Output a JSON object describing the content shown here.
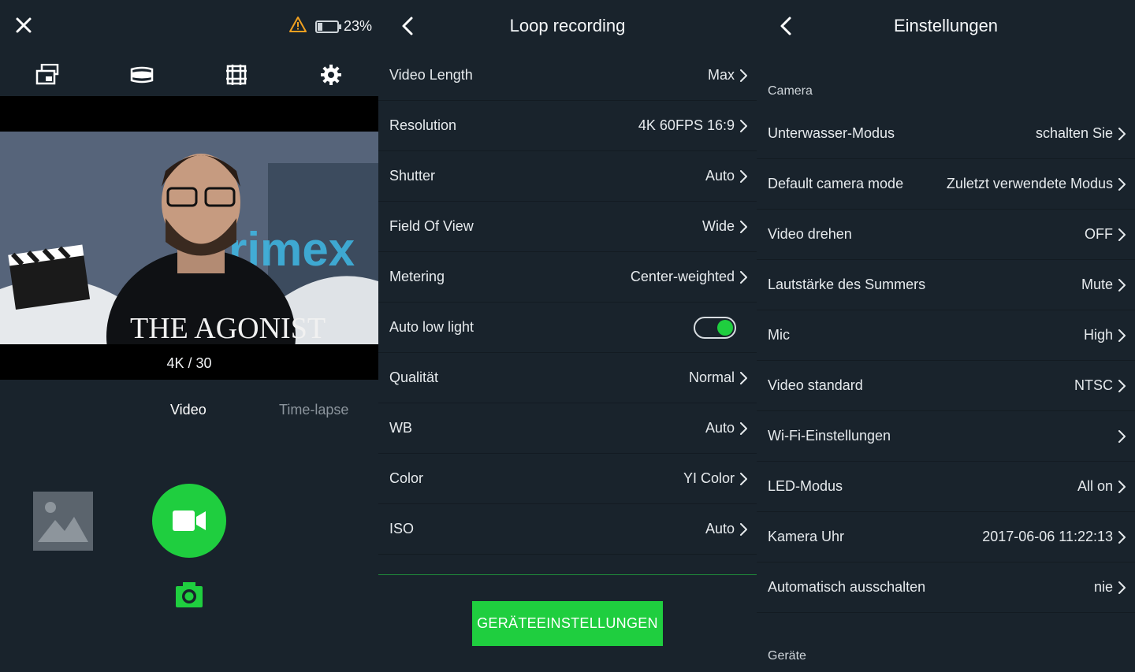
{
  "camera": {
    "battery_percent": "23%",
    "battery_level": 0.23,
    "resolution_label": "4K / 30",
    "mode_video": "Video",
    "mode_timelapse": "Time-lapse",
    "preview_scene_text": "THE AGONIST",
    "preview_banner_text": "rimex"
  },
  "loop": {
    "title": "Loop recording",
    "rows": [
      {
        "label": "Video Length",
        "value": "Max"
      },
      {
        "label": "Resolution",
        "value": "4K 60FPS 16:9"
      },
      {
        "label": "Shutter",
        "value": "Auto"
      },
      {
        "label": "Field Of View",
        "value": "Wide"
      },
      {
        "label": "Metering",
        "value": "Center-weighted"
      },
      {
        "label": "Auto low light",
        "value": "",
        "toggle": true
      },
      {
        "label": "Qualität",
        "value": "Normal"
      },
      {
        "label": "WB",
        "value": "Auto"
      },
      {
        "label": "Color",
        "value": "YI Color"
      },
      {
        "label": "ISO",
        "value": "Auto"
      }
    ],
    "device_button": "GERÄTEEINSTELLUNGEN"
  },
  "einst": {
    "title": "Einstellungen",
    "section_camera": "Camera",
    "section_devices": "Geräte",
    "rows": [
      {
        "label": "Unterwasser-Modus",
        "value": "schalten Sie"
      },
      {
        "label": "Default camera mode",
        "value": "Zuletzt verwendete Modus"
      },
      {
        "label": "Video drehen",
        "value": "OFF"
      },
      {
        "label": "Lautstärke des Summers",
        "value": "Mute"
      },
      {
        "label": "Mic",
        "value": "High"
      },
      {
        "label": "Video standard",
        "value": "NTSC"
      },
      {
        "label": "Wi-Fi-Einstellungen",
        "value": ""
      },
      {
        "label": "LED-Modus",
        "value": "All on"
      },
      {
        "label": "Kamera Uhr",
        "value": "2017-06-06 11:22:13"
      },
      {
        "label": "Automatisch ausschalten",
        "value": "nie"
      }
    ]
  },
  "colors": {
    "accent": "#1fce3f",
    "background": "#19232c",
    "warning": "#f0a020"
  }
}
